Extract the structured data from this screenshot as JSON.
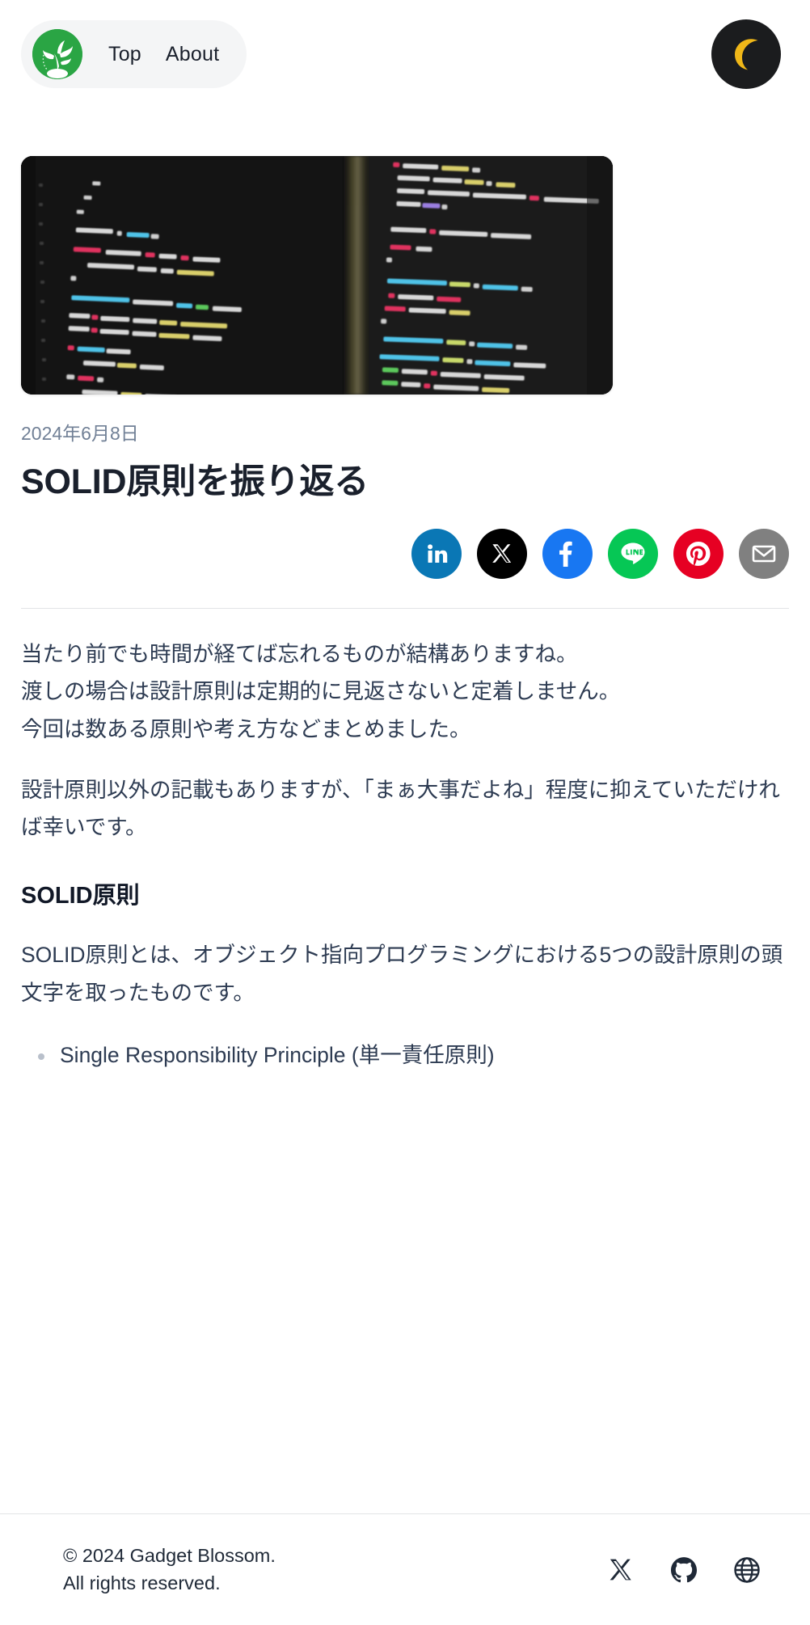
{
  "header": {
    "logo_icon": "plant-sprout-logo-icon",
    "logo_color": "#2aa544",
    "nav": [
      {
        "label": "Top",
        "name": "nav-link-top"
      },
      {
        "label": "About",
        "name": "nav-link-about"
      }
    ],
    "theme_toggle": {
      "icon": "crescent-moon-icon",
      "bg_color": "#1b1c1e",
      "moon_color": "#f0b718"
    }
  },
  "hero": {
    "alt": "blurred photo of source code on a dark editor screen",
    "background": "#1d1d1d"
  },
  "article": {
    "date": "2024年6月8日",
    "title": "SOLID原則を振り返る",
    "paragraphs": {
      "intro_line1": "当たり前でも時間が経てば忘れるものが結構ありますね。",
      "intro_line2": "渡しの場合は設計原則は定期的に見返さないと定着しません。",
      "intro_line3": "今回は数ある原則や考え方などまとめました。",
      "second": "設計原則以外の記載もありますが、「まぁ大事だよね」程度に抑えていただければ幸いです。"
    },
    "heading_solid": "SOLID原則",
    "solid_intro": "SOLID原則とは、オブジェクト指向プログラミングにおける5つの設計原則の頭文字を取ったものです。",
    "list": [
      "Single Responsibility Principle (単一責任原則)"
    ]
  },
  "share": {
    "buttons": [
      {
        "name": "share-linkedin-button",
        "label": "LinkedIn",
        "icon": "linkedin-icon",
        "color": "#0a77b5"
      },
      {
        "name": "share-x-button",
        "label": "X",
        "icon": "x-twitter-icon",
        "color": "#000000"
      },
      {
        "name": "share-facebook-button",
        "label": "Facebook",
        "icon": "facebook-icon",
        "color": "#1877f2"
      },
      {
        "name": "share-line-button",
        "label": "LINE",
        "icon": "line-icon",
        "color": "#06c755"
      },
      {
        "name": "share-pinterest-button",
        "label": "Pinterest",
        "icon": "pinterest-icon",
        "color": "#e60023"
      },
      {
        "name": "share-email-button",
        "label": "Email",
        "icon": "mail-envelope-icon",
        "color": "#808080"
      }
    ]
  },
  "footer": {
    "copyright_line1": "© 2024 Gadget Blossom.",
    "copyright_line2": "All rights reserved.",
    "social": [
      {
        "name": "footer-x-link",
        "label": "X",
        "icon": "x-twitter-icon"
      },
      {
        "name": "footer-github-link",
        "label": "GitHub",
        "icon": "github-icon"
      },
      {
        "name": "footer-website-link",
        "label": "Website",
        "icon": "globe-icon"
      }
    ],
    "icon_color": "#1f2937"
  }
}
